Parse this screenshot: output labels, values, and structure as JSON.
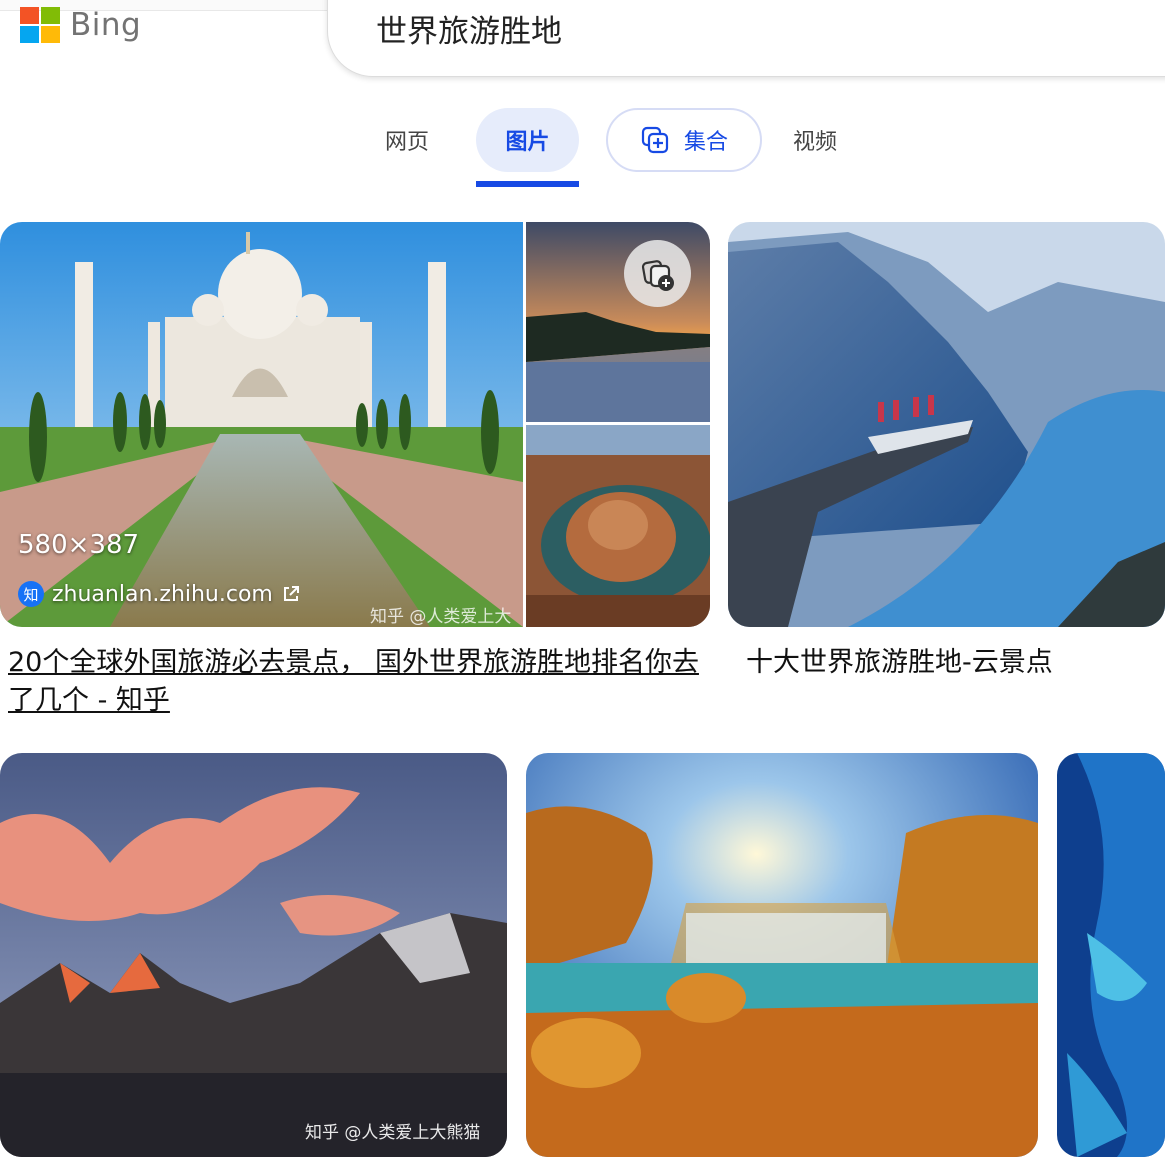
{
  "header": {
    "logo_text": "Bing",
    "query": "世界旅游胜地"
  },
  "tabs": [
    {
      "label": "网页"
    },
    {
      "label": "图片"
    },
    {
      "label": "集合"
    },
    {
      "label": "视频"
    }
  ],
  "colors": {
    "accent": "#174ae4",
    "tab_active_bg": "#e6ecfb"
  },
  "results": [
    {
      "size": "580×387",
      "source": "zhuanlan.zhihu.com",
      "source_badge": "知",
      "title": "20个全球外国旅游必去景点， 国外世界旅游胜地排名你去了几个 - 知乎",
      "watermark": "知乎 @人类爱上大"
    },
    {
      "title": "十大世界旅游胜地-云景点"
    }
  ],
  "row2": {
    "watermark1": "知乎 @人类爱上大熊猫"
  },
  "icons": [
    "microsoft-logo-icon",
    "collection-add-icon",
    "external-link-icon"
  ]
}
